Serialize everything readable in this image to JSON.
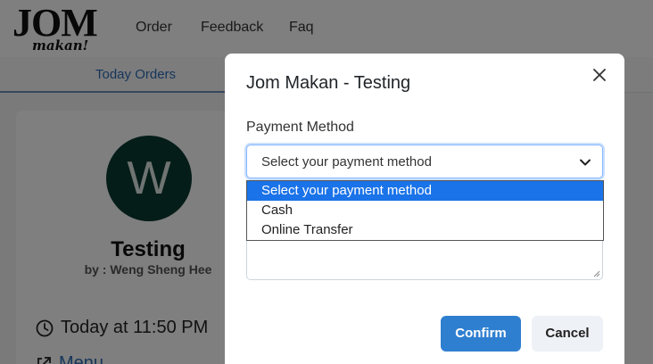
{
  "brand": {
    "logo_text": "JOM",
    "logo_sub": "makan!"
  },
  "nav": {
    "order": "Order",
    "feedback": "Feedback",
    "faq": "Faq"
  },
  "tabs": {
    "active": "Today Orders"
  },
  "card": {
    "avatar_letter": "W",
    "title": "Testing",
    "author": "by : Weng Sheng Hee",
    "time": "Today at 11:50 PM",
    "menu_link": "Menu"
  },
  "modal": {
    "title": "Jom Makan - Testing",
    "payment_label": "Payment Method",
    "select_value": "Select your payment method",
    "options": [
      "Select your payment method",
      "Cash",
      "Online Transfer"
    ],
    "confirm": "Confirm",
    "cancel": "Cancel"
  },
  "colors": {
    "accent": "#2f7fd0",
    "avatar_bg": "#0b3b30",
    "option_highlight": "#1a73e8"
  }
}
